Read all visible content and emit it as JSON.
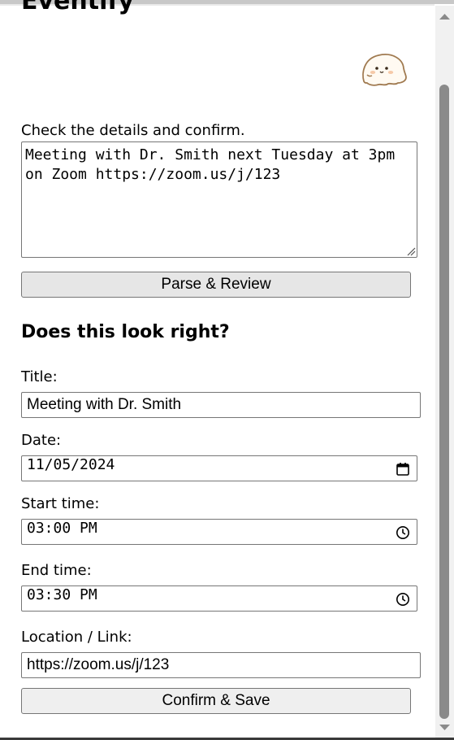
{
  "app": {
    "title": "Eventify"
  },
  "intro": {
    "instruction": "Check the details and confirm."
  },
  "input": {
    "text": "Meeting with Dr. Smith next Tuesday at 3pm on Zoom https://zoom.us/j/123"
  },
  "actions": {
    "parse_label": "Parse & Review",
    "confirm_label": "Confirm & Save"
  },
  "review": {
    "heading": "Does this look right?",
    "title_label": "Title:",
    "title_value": "Meeting with Dr. Smith",
    "date_label": "Date:",
    "date_value": "11/05/2024",
    "start_label": "Start time:",
    "start_value": "03:00 PM",
    "end_label": "End time:",
    "end_value": "03:30 PM",
    "location_label": "Location / Link:",
    "location_value": "https://zoom.us/j/123"
  },
  "icons": {
    "mascot": "ghost-mascot-icon",
    "date_picker": "calendar-icon",
    "time_picker": "clock-icon",
    "resize": "resize-grip-icon",
    "scroll_up": "scroll-up-arrow-icon",
    "scroll_down": "scroll-down-arrow-icon"
  },
  "colors": {
    "border": "#767676",
    "button_bg": "#efefef",
    "scroll_thumb": "#8a8a8a",
    "mascot_outline": "#a07a50"
  }
}
